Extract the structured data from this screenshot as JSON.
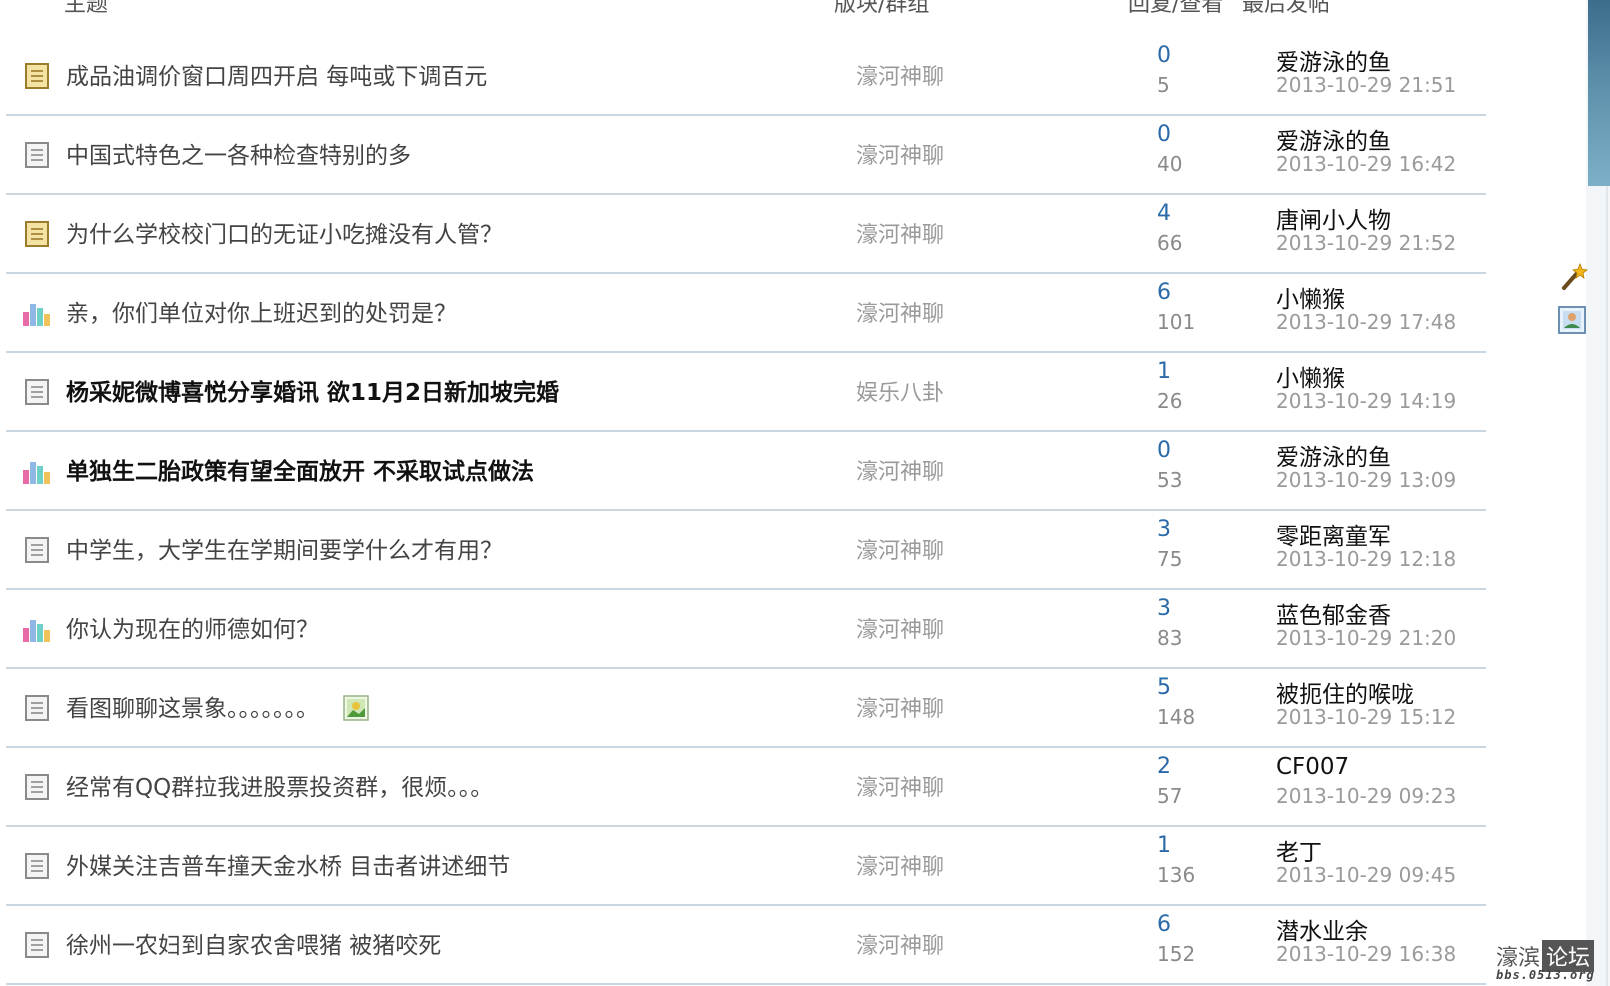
{
  "header": {
    "topic": "主题",
    "forum": "版块/群组",
    "replies_views": "回复/查看",
    "last_post": "最后发帖"
  },
  "threads": [
    {
      "icon": "poll-folder",
      "title": "成品油调价窗口周四开启 每吨或下调百元",
      "bold": false,
      "forum": "濠河神聊",
      "replies": "0",
      "views": "5",
      "author": "爱游泳的鱼",
      "time": "2013-10-29 21:51"
    },
    {
      "icon": "document",
      "title": "中国式特色之一各种检查特别的多",
      "bold": false,
      "forum": "濠河神聊",
      "replies": "0",
      "views": "40",
      "author": "爱游泳的鱼",
      "time": "2013-10-29 16:42"
    },
    {
      "icon": "poll-folder",
      "title": "为什么学校校门口的无证小吃摊没有人管？",
      "bold": false,
      "forum": "濠河神聊",
      "replies": "4",
      "views": "66",
      "author": "唐闸小人物",
      "time": "2013-10-29 21:52"
    },
    {
      "icon": "bar-chart",
      "title": "亲，你们单位对你上班迟到的处罚是？",
      "bold": false,
      "forum": "濠河神聊",
      "replies": "6",
      "views": "101",
      "author": "小懒猴",
      "time": "2013-10-29 17:48"
    },
    {
      "icon": "document",
      "title": "杨采妮微博喜悦分享婚讯 欲11月2日新加坡完婚",
      "bold": true,
      "forum": "娱乐八卦",
      "replies": "1",
      "views": "26",
      "author": "小懒猴",
      "time": "2013-10-29 14:19"
    },
    {
      "icon": "bar-chart",
      "title": "单独生二胎政策有望全面放开 不采取试点做法",
      "bold": true,
      "forum": "濠河神聊",
      "replies": "0",
      "views": "53",
      "author": "爱游泳的鱼",
      "time": "2013-10-29 13:09"
    },
    {
      "icon": "document",
      "title": "中学生，大学生在学期间要学什么才有用？",
      "bold": false,
      "forum": "濠河神聊",
      "replies": "3",
      "views": "75",
      "author": "零距离童军",
      "time": "2013-10-29 12:18"
    },
    {
      "icon": "bar-chart",
      "title": "你认为现在的师德如何？",
      "bold": false,
      "forum": "濠河神聊",
      "replies": "3",
      "views": "83",
      "author": "蓝色郁金香",
      "time": "2013-10-29 21:20"
    },
    {
      "icon": "document",
      "title": "看图聊聊这景象。。。。。。。",
      "bold": false,
      "attachment": true,
      "forum": "濠河神聊",
      "replies": "5",
      "views": "148",
      "author": "被扼住的喉咙",
      "time": "2013-10-29 15:12"
    },
    {
      "icon": "document",
      "title": "经常有QQ群拉我进股票投资群，很烦。。。",
      "bold": false,
      "forum": "濠河神聊",
      "replies": "2",
      "views": "57",
      "author": "CF007",
      "time": "2013-10-29 09:23"
    },
    {
      "icon": "document",
      "title": "外媒关注吉普车撞天金水桥 目击者讲述细节",
      "bold": false,
      "forum": "濠河神聊",
      "replies": "1",
      "views": "136",
      "author": "老丁",
      "time": "2013-10-29 09:45"
    },
    {
      "icon": "document",
      "title": "徐州一农妇到自家农舍喂猪 被猪咬死",
      "bold": false,
      "forum": "濠河神聊",
      "replies": "6",
      "views": "152",
      "author": "潜水业余",
      "time": "2013-10-29 16:38"
    }
  ],
  "watermark": {
    "name_plain": "濠滨",
    "name_boxed": "论坛",
    "url": "bbs.0513.org"
  },
  "colors": {
    "reply_count": "#2a6aa8",
    "row_divider": "#c9d7e3",
    "muted_text": "#9a9a9a"
  }
}
